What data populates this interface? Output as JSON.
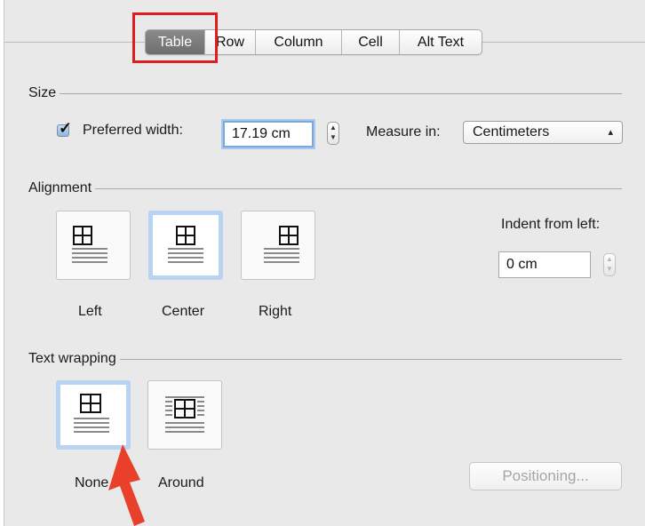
{
  "tabs": [
    "Table",
    "Row",
    "Column",
    "Cell",
    "Alt Text"
  ],
  "size": {
    "section": "Size",
    "preferred_width_label": "Preferred width:",
    "preferred_width_value": "17.19 cm",
    "preferred_width_checked": true,
    "measure_label": "Measure in:",
    "measure_value": "Centimeters"
  },
  "alignment": {
    "section": "Alignment",
    "options": [
      "Left",
      "Center",
      "Right"
    ],
    "selected": "Center",
    "indent_label": "Indent from left:",
    "indent_value": "0 cm"
  },
  "wrapping": {
    "section": "Text wrapping",
    "options": [
      "None",
      "Around"
    ],
    "selected": "None",
    "positioning_label": "Positioning..."
  },
  "colors": {
    "highlight": "#e11b22",
    "arrow": "#e8402a",
    "selected_tile": "#b9d3f2"
  }
}
